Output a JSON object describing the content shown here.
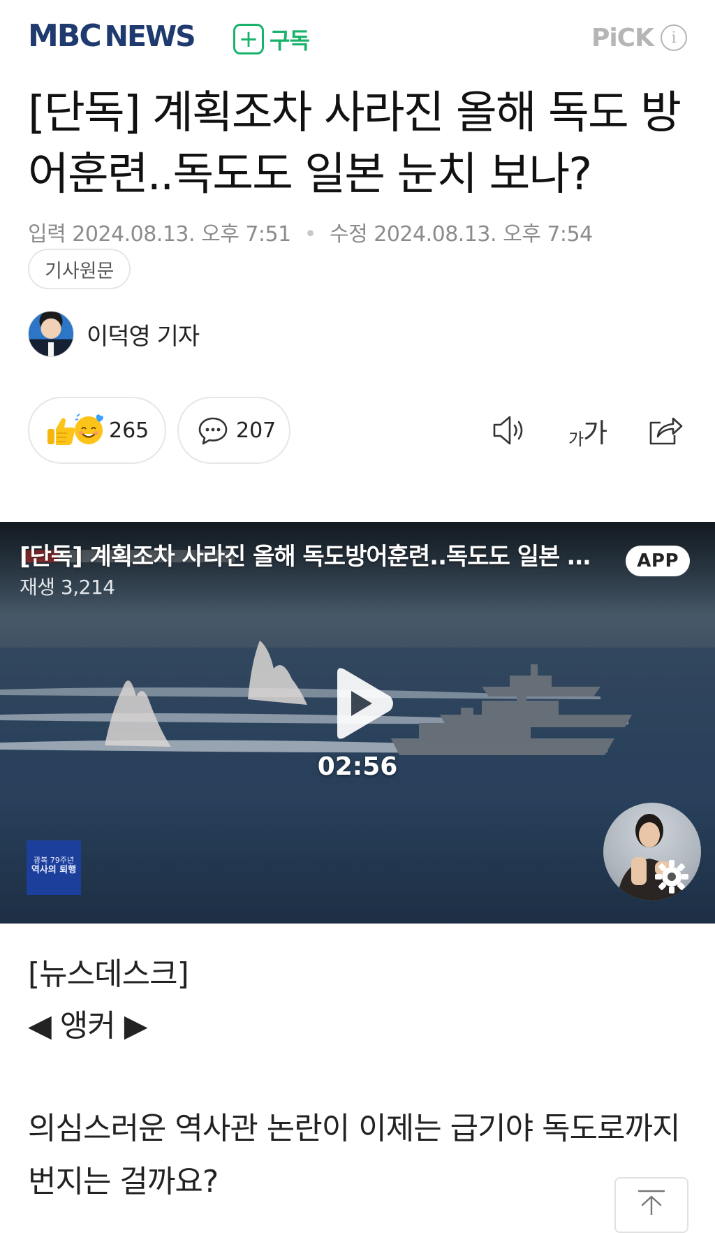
{
  "header": {
    "brand_logo_part1": "MBC",
    "brand_logo_part2": "NEWS",
    "subscribe_label": "구독",
    "pick_label": "PiCK",
    "info_glyph": "i"
  },
  "article": {
    "headline": "[단독] 계획조차 사라진 올해 독도 방어훈련..독도도 일본 눈치 보나?",
    "published_label": "입력",
    "published_at": "2024.08.13. 오후 7:51",
    "modified_label": "수정",
    "modified_at": "2024.08.13. 오후 7:54",
    "original_button": "기사원문",
    "reporter": "이덕영 기자"
  },
  "actions": {
    "reaction_count": "265",
    "comment_count": "207",
    "font_size_small": "가",
    "font_size_big": "가"
  },
  "video": {
    "title": "[단독] 계획조차 사라진 올해 독도방어훈련..독도도 일본 눈치 보나?",
    "views": "재생 3,214",
    "app_badge": "APP",
    "duration": "02:56",
    "channel_logo_line1": "광복 79주년",
    "channel_logo_line2": "역사의 퇴행"
  },
  "body": {
    "section_tag": "[뉴스데스크]",
    "anchor_label": "◀ 앵커 ▶",
    "paragraph": "의심스러운 역사관 논란이 이제는 급기야 독도로까지 번지는 걸까요?"
  },
  "icons": {
    "subscribe": "plus-square-icon",
    "pick_info": "info-circle-icon",
    "reactions": "thumbs-up-emoji-icon",
    "comments": "speech-bubble-icon",
    "tts": "speaker-icon",
    "font_size": "font-size-icon",
    "share": "share-icon",
    "play": "play-icon",
    "settings": "gear-icon",
    "scroll_top": "scroll-top-icon"
  },
  "colors": {
    "brand_navy": "#1f3a6e",
    "subscribe_green": "#18b26b",
    "pick_gray": "#b5b5b5",
    "meta_gray": "#8b8b8b"
  }
}
